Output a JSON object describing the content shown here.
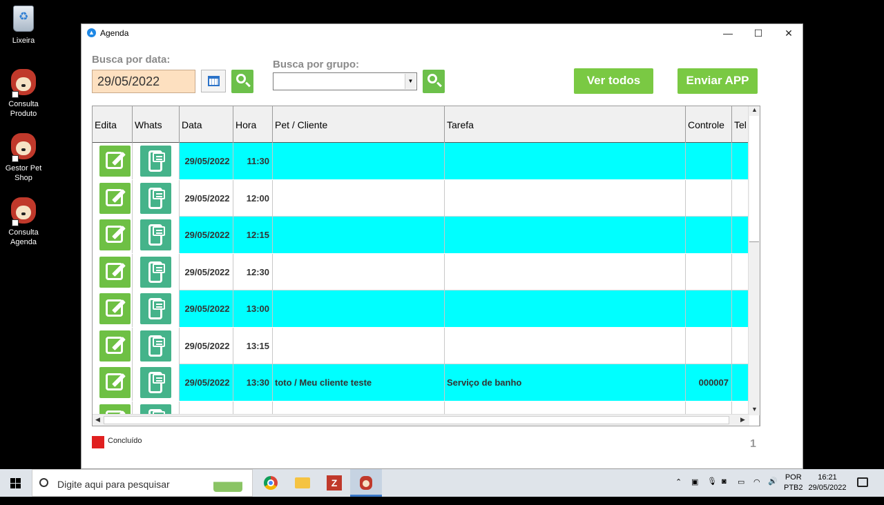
{
  "desktop": {
    "icons": [
      {
        "label": "Lixeira",
        "icon": "recycle-bin-icon"
      },
      {
        "label": "Consulta Produto",
        "icon": "pet-shop-dog-icon"
      },
      {
        "label": "Gestor Pet Shop",
        "icon": "pet-shop-dog-icon"
      },
      {
        "label": "Consulta Agenda",
        "icon": "pet-shop-dog-icon"
      }
    ]
  },
  "window": {
    "title": "Agenda",
    "controls": {
      "minimize": "—",
      "maximize": "☐",
      "close": "✕"
    }
  },
  "filters": {
    "date_label": "Busca por data:",
    "date_value": "29/05/2022",
    "group_label": "Busca por grupo:",
    "group_value": "",
    "ver_todos": "Ver todos",
    "enviar_app": "Enviar APP"
  },
  "grid": {
    "columns": [
      "Edita",
      "Whats",
      "Data",
      "Hora",
      "Pet / Cliente",
      "Tarefa",
      "Controle",
      "Tel"
    ],
    "rows": [
      {
        "data": "29/05/2022",
        "hora": "11:30",
        "pet_cliente": "",
        "tarefa": "",
        "controle": "",
        "highlight": true
      },
      {
        "data": "29/05/2022",
        "hora": "12:00",
        "pet_cliente": "",
        "tarefa": "",
        "controle": "",
        "highlight": false
      },
      {
        "data": "29/05/2022",
        "hora": "12:15",
        "pet_cliente": "",
        "tarefa": "",
        "controle": "",
        "highlight": true
      },
      {
        "data": "29/05/2022",
        "hora": "12:30",
        "pet_cliente": "",
        "tarefa": "",
        "controle": "",
        "highlight": false
      },
      {
        "data": "29/05/2022",
        "hora": "13:00",
        "pet_cliente": "",
        "tarefa": "",
        "controle": "",
        "highlight": true
      },
      {
        "data": "29/05/2022",
        "hora": "13:15",
        "pet_cliente": "",
        "tarefa": "",
        "controle": "",
        "highlight": false
      },
      {
        "data": "29/05/2022",
        "hora": "13:30",
        "pet_cliente": "toto / Meu cliente teste",
        "tarefa": "Serviço de banho",
        "controle": "000007",
        "highlight": true
      },
      {
        "data": "",
        "hora": "",
        "pet_cliente": "",
        "tarefa": "",
        "controle": "",
        "highlight": false
      }
    ]
  },
  "legend": {
    "label": "Concluído",
    "color": "#e02020"
  },
  "page_number": "1",
  "colors": {
    "highlight_row": "#00ffff",
    "green_button": "#7ac943",
    "date_field": "#fde0c0"
  },
  "taskbar": {
    "search_placeholder": "Digite aqui para pesquisar",
    "apps": [
      "chrome-icon",
      "file-explorer-icon",
      "filezilla-icon",
      "pet-shop-dog-icon"
    ],
    "language": "POR",
    "layout": "PTB2",
    "time": "16:21",
    "date": "29/05/2022"
  }
}
